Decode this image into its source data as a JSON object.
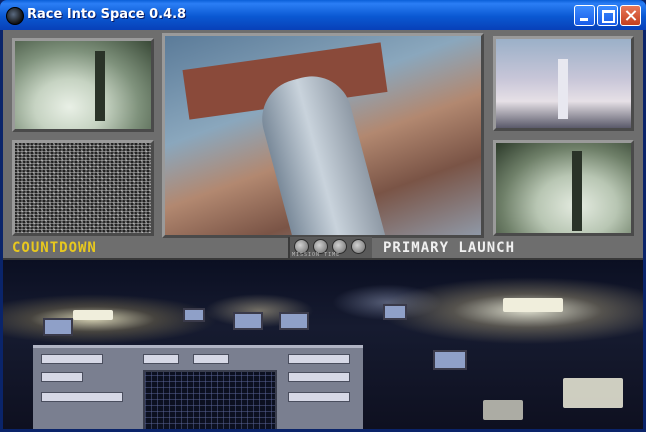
{
  "window": {
    "title": "Race Into Space 0.4.8",
    "icon": "globe-icon",
    "controls": [
      "minimize",
      "maximize",
      "close"
    ]
  },
  "panel": {
    "left_label": "COUNTDOWN",
    "right_label": "PRIMARY LAUNCH",
    "mission_time_label": "MISSION TIME"
  },
  "colors": {
    "countdown": "#e8c81e",
    "primary_launch": "#f0f0f0",
    "titlebar": "#0a58d2",
    "panel": "#6e6e6e"
  }
}
